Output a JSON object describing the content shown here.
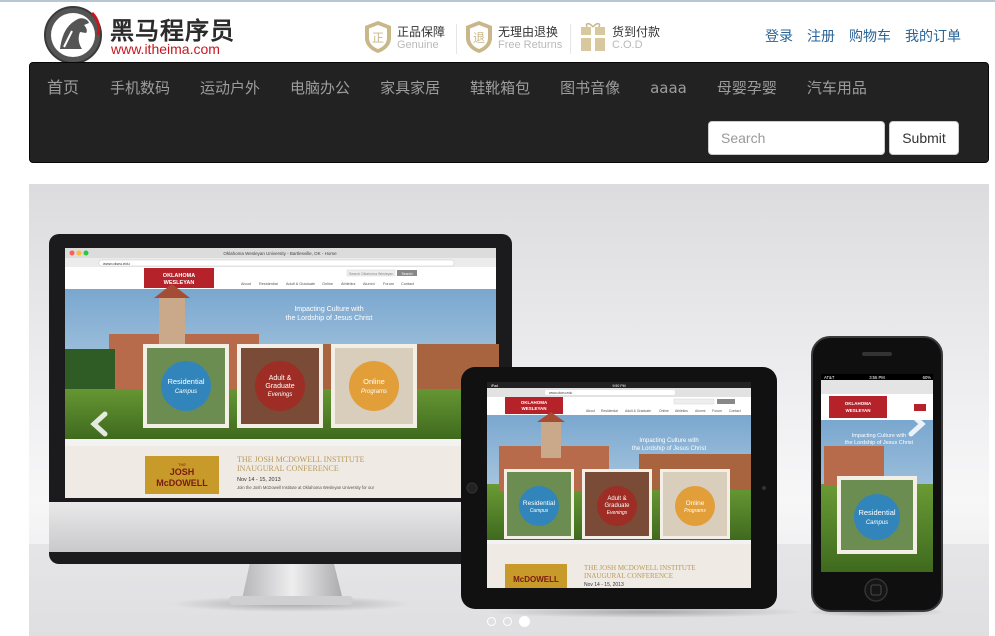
{
  "brand": {
    "name_cn": "黑马程序员",
    "url": "www.itheima.com"
  },
  "promises": [
    {
      "icon": "genuine-shield-icon",
      "title": "正品保障",
      "subtitle": "Genuine"
    },
    {
      "icon": "free-returns-shield-icon",
      "title": "无理由退换",
      "subtitle": "Free Returns"
    },
    {
      "icon": "gift-box-icon",
      "title": "货到付款",
      "subtitle": "C.O.D"
    }
  ],
  "user_links": [
    "登录",
    "注册",
    "购物车",
    "我的订单"
  ],
  "nav": {
    "items": [
      "首页",
      "手机数码",
      "运动户外",
      "电脑办公",
      "家具家居",
      "鞋靴箱包",
      "图书音像",
      "aaaa",
      "母婴孕婴",
      "汽车用品"
    ],
    "search_placeholder": "Search",
    "submit_label": "Submit"
  },
  "carousel": {
    "slides": 3,
    "active_slide": 3,
    "slide_content": {
      "browser_title": "Oklahoma Wesleyan University - Bartlesville, OK - Home",
      "address": "www.okwu.edu",
      "school_line1": "OKLAHOMA",
      "school_line2": "WESLEYAN",
      "search_box": "Search Oklahoma Wesleyan",
      "search_btn": "Search",
      "menu": [
        "About",
        "Residential",
        "Adult & Graduate",
        "Online",
        "Athletics",
        "Alumni",
        "Forum",
        "Contact"
      ],
      "tagline1": "Impacting Culture with",
      "tagline2": "the Lordship of Jesus Christ",
      "circles": [
        {
          "l1": "Residential",
          "l2": "Campus"
        },
        {
          "l1": "Adult &",
          "l2": "Graduate",
          "l3": "Evenings"
        },
        {
          "l1": "Online",
          "l2": "Programs"
        }
      ],
      "event_title1": "THE JOSH MCDOWELL INSTITUTE",
      "event_title2": "INAUGURAL CONFERENCE",
      "event_date": "Nov 14 - 15, 2013",
      "event_desc": "Join the Josh McDowell Institute at Oklahoma Wesleyan University for our",
      "book_line1": "JOSH",
      "book_line2": "McDOWELL",
      "book_small": "THE",
      "book_small2": "INSTITUTE",
      "phone_carrier": "AT&T",
      "phone_time": "3:55 PM",
      "phone_batt": "60%",
      "tablet_label": "iPad",
      "tablet_time": "9:50 PM"
    }
  }
}
